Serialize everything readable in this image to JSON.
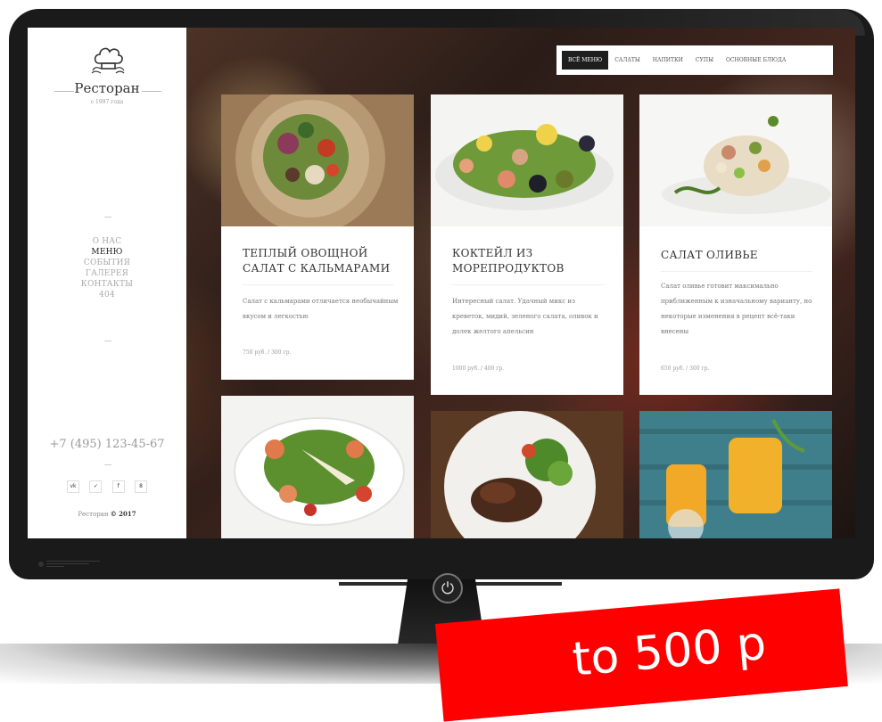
{
  "sidebar": {
    "brand": "Ресторан",
    "since": "с 1997 года",
    "nav": [
      "О НАС",
      "МЕНЮ",
      "СОБЫТИЯ",
      "ГАЛЕРЕЯ",
      "КОНТАКТЫ",
      "404"
    ],
    "active_nav": "МЕНЮ",
    "phone": "+7 (495) 123-45-67",
    "socials": [
      "vk-icon",
      "twitter-icon",
      "facebook-icon",
      "odnoklassniki-icon"
    ],
    "social_labels": [
      "vk",
      "✓",
      "f",
      "8"
    ],
    "copyright_name": "Ресторан",
    "copyright_year": "© 2017"
  },
  "menu_tabs": [
    "ВСЁ МЕНЮ",
    "САЛАТЫ",
    "НАПИТКИ",
    "СУПЫ",
    "ОСНОВНЫЕ БЛЮДА"
  ],
  "active_tab": "ВСЁ МЕНЮ",
  "cards": [
    {
      "title": "ТЕПЛЫЙ ОВОЩНОЙ САЛАТ С КАЛЬМАРАМИ",
      "description": "Салат с кальмарами отличается необычайным вкусом и легкостью",
      "price": "750 руб. / 300 гр."
    },
    {
      "title": "КОКТЕЙЛ ИЗ МОРЕПРОДУКТОВ",
      "description": "Интересный салат. Удачный микс из креветок, мидий, зеленого салата, оливок и долек желтого апельсин",
      "price": "1000 руб. / 400 гр."
    },
    {
      "title": "САЛАТ ОЛИВЬЕ",
      "description": "Салат оливье готовит максимально приближенным к изначальному варианту, но некоторые изменения в рецепт всё-таки внесены",
      "price": "650 руб. / 300 гр."
    }
  ],
  "price_banner": "to 500 p",
  "colors": {
    "bezel": "#1a1a1a",
    "banner": "#ff0000",
    "menu_active": "#1e1e1e"
  }
}
